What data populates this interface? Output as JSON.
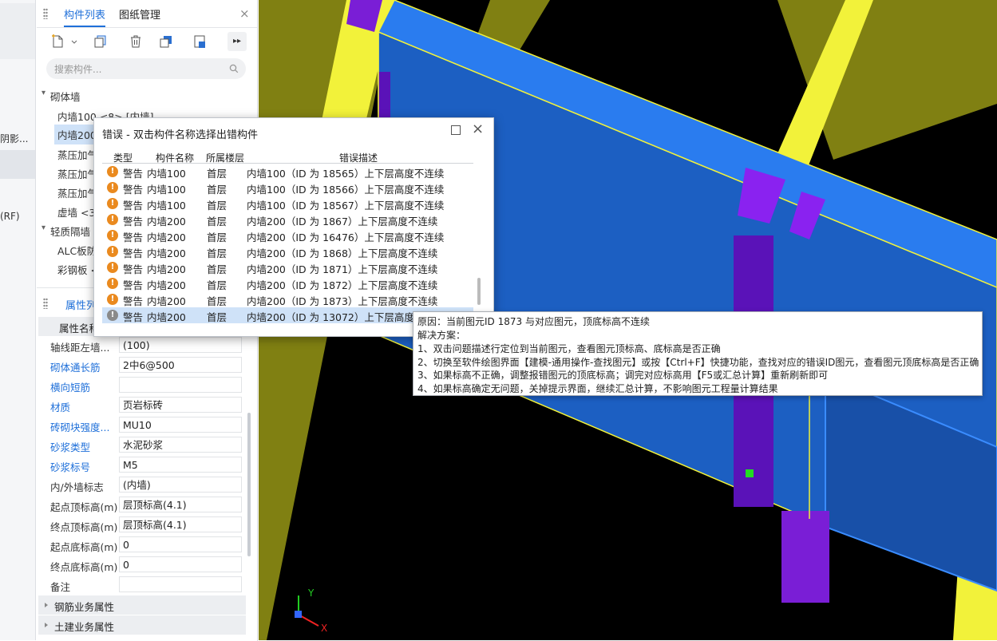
{
  "left_strip": {
    "frag1": "阴影...",
    "frag2": "(RF)"
  },
  "component_panel": {
    "tabs": [
      "构件列表",
      "图纸管理"
    ],
    "search_placeholder": "搜索构件...",
    "tree": {
      "cat1": "砌体墙",
      "items1": [
        "内墙100 <8> [内墙]",
        "内墙200",
        "蒸压加气",
        "蒸压加气",
        "蒸压加气",
        "虚墙 <3"
      ],
      "cat2": "轻质隔墙",
      "items2": [
        "ALC板防",
        "彩钢板 <"
      ]
    }
  },
  "properties": {
    "tab": "属性列",
    "col_header": "属性名称",
    "rows": [
      {
        "label": "轴线距左墙...",
        "value": "(100)",
        "blue": false
      },
      {
        "label": "砌体通长筋",
        "value": "2中6@500",
        "blue": true
      },
      {
        "label": "横向短筋",
        "value": "",
        "blue": true
      },
      {
        "label": "材质",
        "value": "页岩标砖",
        "blue": true
      },
      {
        "label": "砖砌块强度...",
        "value": "MU10",
        "blue": true
      },
      {
        "label": "砂浆类型",
        "value": "水泥砂浆",
        "blue": true
      },
      {
        "label": "砂浆标号",
        "value": "M5",
        "blue": true
      },
      {
        "label": "内/外墙标志",
        "value": "(内墙)",
        "blue": false
      },
      {
        "label": "起点顶标高(m)",
        "value": "层顶标高(4.1)",
        "blue": false
      },
      {
        "label": "终点顶标高(m)",
        "value": "层顶标高(4.1)",
        "blue": false
      },
      {
        "label": "起点底标高(m)",
        "value": "0",
        "blue": false
      },
      {
        "label": "终点底标高(m)",
        "value": "0",
        "blue": false
      },
      {
        "label": "备注",
        "value": "",
        "blue": false
      }
    ],
    "groups": [
      "钢筋业务属性",
      "土建业务属性"
    ]
  },
  "error_dialog": {
    "title": "错误 - 双击构件名称选择出错构件",
    "columns": [
      "类型",
      "构件名称",
      "所属楼层",
      "错误描述"
    ],
    "rows": [
      {
        "type": "警告",
        "name": "内墙100",
        "floor": "首层",
        "desc": "内墙100（ID 为 18565）上下层高度不连续"
      },
      {
        "type": "警告",
        "name": "内墙100",
        "floor": "首层",
        "desc": "内墙100（ID 为 18566）上下层高度不连续"
      },
      {
        "type": "警告",
        "name": "内墙100",
        "floor": "首层",
        "desc": "内墙100（ID 为 18567）上下层高度不连续"
      },
      {
        "type": "警告",
        "name": "内墙200",
        "floor": "首层",
        "desc": "内墙200（ID 为 1867）上下层高度不连续"
      },
      {
        "type": "警告",
        "name": "内墙200",
        "floor": "首层",
        "desc": "内墙200（ID 为 16476）上下层高度不连续"
      },
      {
        "type": "警告",
        "name": "内墙200",
        "floor": "首层",
        "desc": "内墙200（ID 为 1868）上下层高度不连续"
      },
      {
        "type": "警告",
        "name": "内墙200",
        "floor": "首层",
        "desc": "内墙200（ID 为 1871）上下层高度不连续"
      },
      {
        "type": "警告",
        "name": "内墙200",
        "floor": "首层",
        "desc": "内墙200（ID 为 1872）上下层高度不连续"
      },
      {
        "type": "警告",
        "name": "内墙200",
        "floor": "首层",
        "desc": "内墙200（ID 为 1873）上下层高度不连续"
      },
      {
        "type": "警告",
        "name": "内墙200",
        "floor": "首层",
        "desc": "内墙200（ID 为 13072）上下层高度不连续"
      }
    ]
  },
  "tooltip": {
    "reason": "原因：当前图元ID 1873 与对应图元，顶底标高不连续",
    "solution_title": "解决方案：",
    "steps": [
      "1、双击问题描述行定位到当前图元，查看图元顶标高、底标高是否正确",
      "2、切换至软件绘图界面【建模-通用操作-查找图元】或按【Ctrl+F】快捷功能，查找对应的错误ID图元，查看图元顶底标高是否正确",
      "3、如果标高不正确，调整报错图元的顶底标高；调完对应标高用【F5或汇总计算】重新刷新即可",
      "4、如果标高确定无问题，关掉提示界面，继续汇总计算，不影响图元工程量计算结果"
    ]
  },
  "axis": {
    "x": "X",
    "y": "Y"
  },
  "colors": {
    "accent": "#1e6fd9",
    "viewport_bg": "#000000",
    "warning": "#ea8a1f"
  }
}
